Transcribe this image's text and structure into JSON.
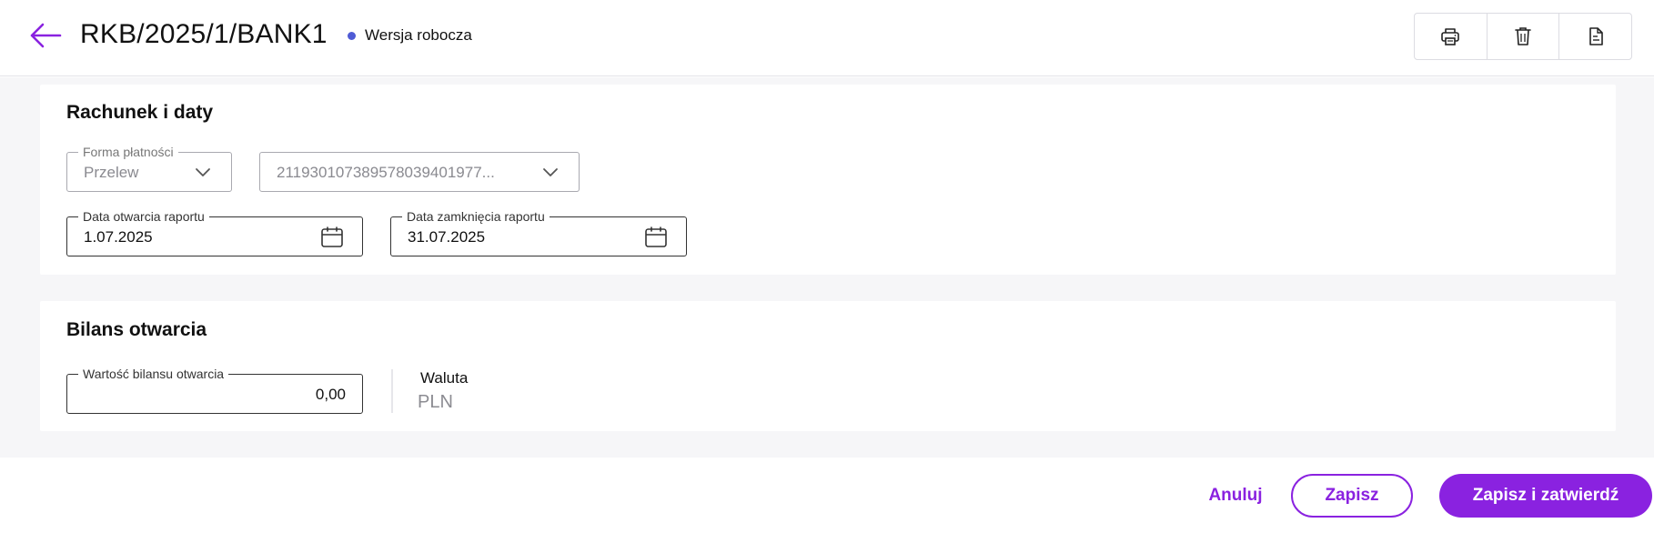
{
  "header": {
    "title": "RKB/2025/1/BANK1",
    "status": "Wersja robocza",
    "status_color": "#4f5bd5",
    "toolbar": [
      "printer-icon",
      "trash-icon",
      "document-icon"
    ]
  },
  "account_section": {
    "title": "Rachunek i daty",
    "payment_form": {
      "label": "Forma płatności",
      "value": "Przelew"
    },
    "account_number": {
      "value": "211930107389578039401977..."
    },
    "open_date": {
      "label": "Data otwarcia raportu",
      "value": "1.07.2025"
    },
    "close_date": {
      "label": "Data zamknięcia raportu",
      "value": "31.07.2025"
    }
  },
  "balance_section": {
    "title": "Bilans otwarcia",
    "opening_balance": {
      "label": "Wartość bilansu otwarcia",
      "value": "0,00"
    },
    "currency": {
      "label": "Waluta",
      "value": "PLN"
    }
  },
  "footer": {
    "cancel": "Anuluj",
    "save": "Zapisz",
    "save_confirm": "Zapisz i zatwierdź"
  },
  "colors": {
    "accent": "#8a22e0"
  }
}
